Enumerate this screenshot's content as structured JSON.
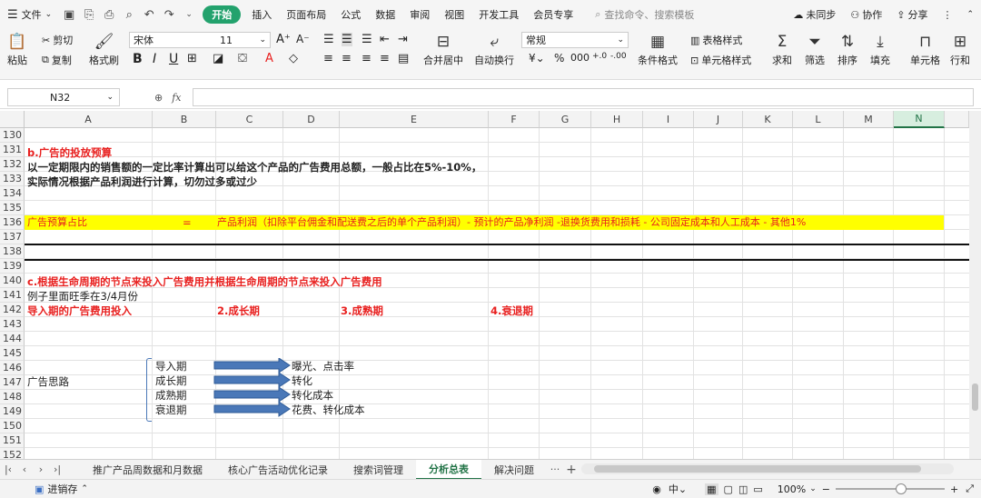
{
  "menubar": {
    "file": "文件",
    "tabs": [
      "开始",
      "插入",
      "页面布局",
      "公式",
      "数据",
      "审阅",
      "视图",
      "开发工具",
      "会员专享"
    ],
    "search_placeholder": "查找命令、搜索模板",
    "sync": "未同步",
    "collab": "协作",
    "share": "分享"
  },
  "ribbon": {
    "paste": "粘贴",
    "cut": "剪切",
    "copy": "复制",
    "format_painter": "格式刷",
    "font_name": "宋体",
    "font_size": "11",
    "merge_center": "合并居中",
    "wrap_text": "自动换行",
    "number_format": "常规",
    "conditional_format": "条件格式",
    "table_style": "表格样式",
    "cell_style": "单元格样式",
    "sum": "求和",
    "filter": "筛选",
    "sort": "排序",
    "fill": "填充",
    "cell": "单元格",
    "rowcol": "行和"
  },
  "formula_bar": {
    "name_box": "N32",
    "fx": "fx",
    "content": ""
  },
  "columns": [
    "A",
    "B",
    "C",
    "D",
    "E",
    "F",
    "G",
    "H",
    "I",
    "J",
    "K",
    "L",
    "M",
    "N"
  ],
  "selected_column": "N",
  "rows": [
    "130",
    "131",
    "132",
    "133",
    "134",
    "135",
    "136",
    "137",
    "138",
    "139",
    "140",
    "141",
    "142",
    "143",
    "144",
    "145",
    "146",
    "147",
    "148",
    "149",
    "150",
    "151",
    "152"
  ],
  "cells": {
    "r131": "b.广告的投放预算",
    "r132": "以一定期限内的销售额的一定比率计算出可以给这个产品的广告费用总额，一般占比在5%-10%，",
    "r133": "实际情况根据产品利润进行计算，切勿过多或过少",
    "r136a": "广告预算占比",
    "r136b": "=",
    "r136c": "产品利润（扣除平台佣金和配送费之后的单个产品利润）- 预计的产品净利润 -退换货费用和损耗 - 公司固定成本和人工成本 - 其他1%",
    "r140": "c.根据生命周期的节点来投入广告费用并根据生命周期的节点来投入广告费用",
    "r141": "例子里面旺季在3/4月份",
    "r142a": "导入期的广告费用投入",
    "r142c": "2.成长期",
    "r142e": "3.成熟期",
    "r142f": "4.衰退期",
    "r147a": "广告思路",
    "stages": [
      "导入期",
      "成长期",
      "成熟期",
      "衰退期"
    ],
    "results": [
      "曝光、点击率",
      "转化",
      "转化成本",
      "花费、转化成本"
    ]
  },
  "sheet_tabs": [
    "推广产品周数据和月数据",
    "核心广告活动优化记录",
    "搜索词管理",
    "分析总表",
    "解决问题"
  ],
  "active_tab": "分析总表",
  "tab_more": "···",
  "status": {
    "macro": "进销存",
    "zoom": "100%"
  },
  "colors": {
    "accent_green": "#23a26d",
    "red_text": "#e8201f",
    "highlight_yellow": "#ffff00",
    "arrow_fill": "#4a78b8"
  }
}
